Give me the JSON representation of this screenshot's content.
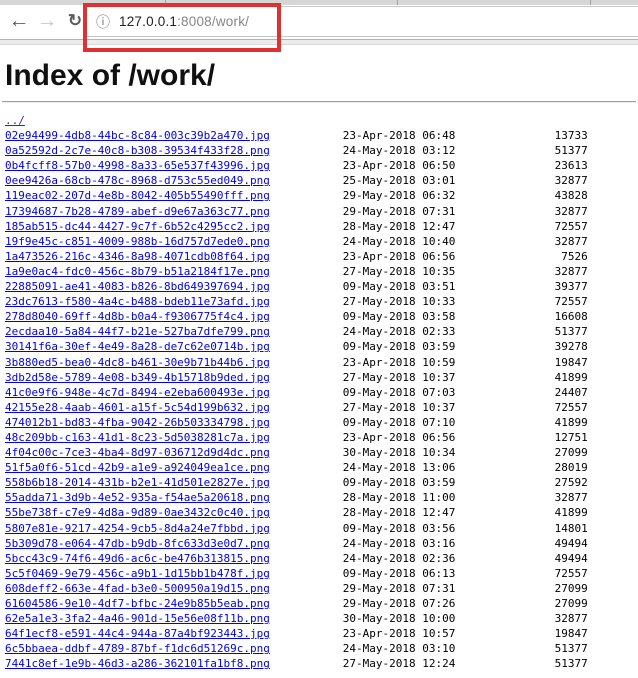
{
  "browser": {
    "back_label": "←",
    "forward_label": "→",
    "reload_label": "↻",
    "info_icon": "ⓘ",
    "url_host": "127.0.0.1",
    "url_rest": ":8008/work/",
    "annotation_color": "#e03131"
  },
  "page": {
    "title": "Index of /work/"
  },
  "listing": {
    "parent_link": "../",
    "files": [
      {
        "name": "02e94499-4db8-44bc-8c84-003c39b2a470.jpg",
        "date": "23-Apr-2018 06:48",
        "size": "13733"
      },
      {
        "name": "0a52592d-2c7e-40c8-b308-39534f433f28.png",
        "date": "24-May-2018 03:12",
        "size": "51377"
      },
      {
        "name": "0b4fcff8-57b0-4998-8a33-65e537f43996.jpg",
        "date": "23-Apr-2018 06:50",
        "size": "23613"
      },
      {
        "name": "0ee9426a-68cb-478c-8968-d753c55ed049.png",
        "date": "25-May-2018 03:01",
        "size": "32877"
      },
      {
        "name": "119eac02-207d-4e8b-8042-405b55490fff.png",
        "date": "29-May-2018 06:32",
        "size": "43828"
      },
      {
        "name": "17394687-7b28-4789-abef-d9e67a363c77.png",
        "date": "29-May-2018 07:31",
        "size": "32877"
      },
      {
        "name": "185ab515-dc44-4427-9c7f-6b52c4295cc2.jpg",
        "date": "28-May-2018 12:47",
        "size": "72557"
      },
      {
        "name": "19f9e45c-c851-4009-988b-16d757d7ede0.png",
        "date": "24-May-2018 10:40",
        "size": "32877"
      },
      {
        "name": "1a473526-216c-4346-8a98-4071cdb08f64.jpg",
        "date": "23-Apr-2018 06:56",
        "size": "7526"
      },
      {
        "name": "1a9e0ac4-fdc0-456c-8b79-b51a2184f17e.png",
        "date": "27-May-2018 10:35",
        "size": "32877"
      },
      {
        "name": "22885091-ae41-4083-b826-8bd649397694.jpg",
        "date": "09-May-2018 03:51",
        "size": "39377"
      },
      {
        "name": "23dc7613-f580-4a4c-b488-bdeb11e73afd.jpg",
        "date": "27-May-2018 10:33",
        "size": "72557"
      },
      {
        "name": "278d8040-69ff-4d8b-b0a4-f9306775f4c4.jpg",
        "date": "09-May-2018 03:58",
        "size": "16608"
      },
      {
        "name": "2ecdaa10-5a84-44f7-b21e-527ba7dfe799.png",
        "date": "24-May-2018 02:33",
        "size": "51377"
      },
      {
        "name": "30141f6a-30ef-4e49-8a28-de7c62e0714b.jpg",
        "date": "09-May-2018 03:59",
        "size": "39278"
      },
      {
        "name": "3b880ed5-bea0-4dc8-b461-30e9b71b44b6.jpg",
        "date": "23-Apr-2018 10:59",
        "size": "19847"
      },
      {
        "name": "3db2d58e-5789-4e08-b349-4b15718b9ded.jpg",
        "date": "27-May-2018 10:37",
        "size": "41899"
      },
      {
        "name": "41c0e9f6-948e-4c7d-8494-e2eba600493e.jpg",
        "date": "09-May-2018 07:03",
        "size": "24407"
      },
      {
        "name": "42155e28-4aab-4601-a15f-5c54d199b632.jpg",
        "date": "27-May-2018 10:37",
        "size": "72557"
      },
      {
        "name": "474012b1-bd83-4fba-9042-26b503334798.jpg",
        "date": "09-May-2018 07:10",
        "size": "41899"
      },
      {
        "name": "48c209bb-c163-41d1-8c23-5d5038281c7a.jpg",
        "date": "23-Apr-2018 06:56",
        "size": "12751"
      },
      {
        "name": "4f04c00c-7ce3-4ba4-8d97-036712d9d4dc.png",
        "date": "30-May-2018 10:34",
        "size": "27099"
      },
      {
        "name": "51f5a0f6-51cd-42b9-a1e9-a924049ea1ce.png",
        "date": "24-May-2018 13:06",
        "size": "28019"
      },
      {
        "name": "558b6b18-2014-431b-b2e1-41d501e2827e.jpg",
        "date": "09-May-2018 03:59",
        "size": "27592"
      },
      {
        "name": "55adda71-3d9b-4e52-935a-f54ae5a20618.png",
        "date": "28-May-2018 11:00",
        "size": "32877"
      },
      {
        "name": "55be738f-c7e9-4d8a-9d89-0ae3432c0c40.jpg",
        "date": "28-May-2018 12:47",
        "size": "41899"
      },
      {
        "name": "5807e81e-9217-4254-9cb5-8d4a24e7fbbd.jpg",
        "date": "09-May-2018 03:56",
        "size": "14801"
      },
      {
        "name": "5b309d78-e064-47db-b9db-8fc633d3e0d7.png",
        "date": "24-May-2018 03:16",
        "size": "49494"
      },
      {
        "name": "5bcc43c9-74f6-49d6-ac6c-be476b313815.png",
        "date": "24-May-2018 02:36",
        "size": "49494"
      },
      {
        "name": "5c5f0469-9e79-456c-a9b1-1d15bb1b478f.jpg",
        "date": "09-May-2018 06:13",
        "size": "72557"
      },
      {
        "name": "608deff2-663e-4fad-b3e0-500950a19d15.png",
        "date": "29-May-2018 07:31",
        "size": "27099"
      },
      {
        "name": "61604586-9e10-4df7-bfbc-24e9b85b5eab.png",
        "date": "29-May-2018 07:26",
        "size": "27099"
      },
      {
        "name": "62e5a1e3-3fa2-4a46-901d-15e56e08f11b.png",
        "date": "30-May-2018 10:00",
        "size": "32877"
      },
      {
        "name": "64f1ecf8-e591-44c4-944a-87a4bf923443.jpg",
        "date": "23-Apr-2018 10:57",
        "size": "19847"
      },
      {
        "name": "6c5bbaea-ddbf-4789-87bf-f1dc6d51269c.png",
        "date": "24-May-2018 03:10",
        "size": "51377"
      },
      {
        "name": "7441c8ef-1e9b-46d3-a286-362101fa1bf8.png",
        "date": "27-May-2018 12:24",
        "size": "51377"
      }
    ]
  }
}
